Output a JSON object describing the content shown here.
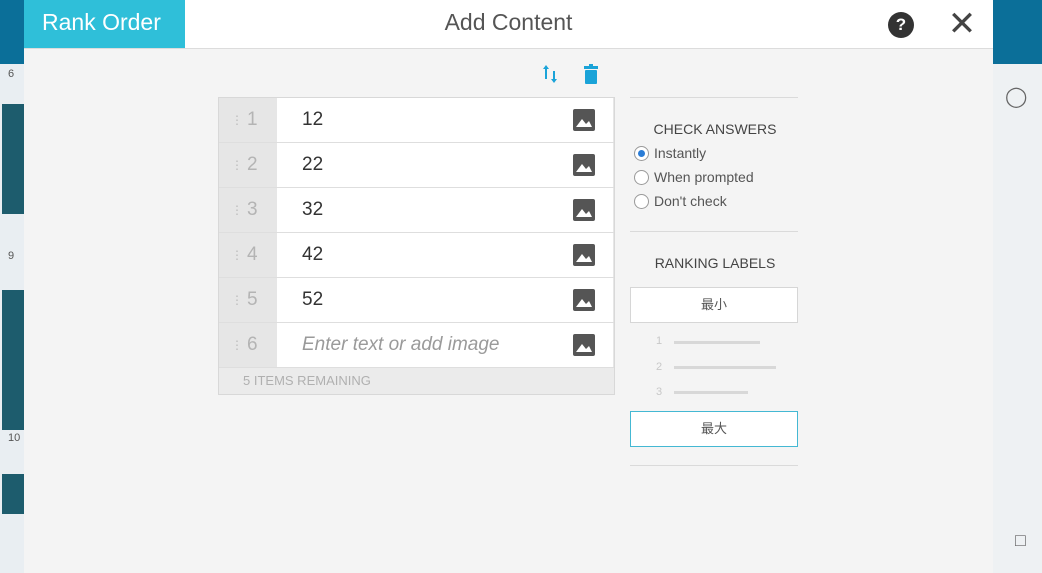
{
  "background": {
    "left_numbers": [
      "6",
      "9",
      "10"
    ]
  },
  "header": {
    "tab_label": "Rank Order",
    "title": "Add Content"
  },
  "toolbar": {
    "sort_icon": "sort-arrows-icon",
    "delete_icon": "trash-icon"
  },
  "items": [
    {
      "index": "1",
      "text": "12"
    },
    {
      "index": "2",
      "text": "22"
    },
    {
      "index": "3",
      "text": "32"
    },
    {
      "index": "4",
      "text": "42"
    },
    {
      "index": "5",
      "text": "52"
    },
    {
      "index": "6",
      "placeholder": "Enter text or add image"
    }
  ],
  "items_remaining": "5 ITEMS REMAINING",
  "check_answers": {
    "title": "CHECK ANSWERS",
    "options": [
      "Instantly",
      "When prompted",
      "Don't check"
    ],
    "selected": "Instantly"
  },
  "ranking_labels": {
    "title": "RANKING LABELS",
    "min_label": "最小",
    "max_label": "最大",
    "preview_numbers": [
      "1",
      "2",
      "3"
    ]
  },
  "colors": {
    "brand": "#2fbfd9",
    "accent_icon": "#1aa3d8",
    "radio_selected": "#2a7cd6"
  }
}
